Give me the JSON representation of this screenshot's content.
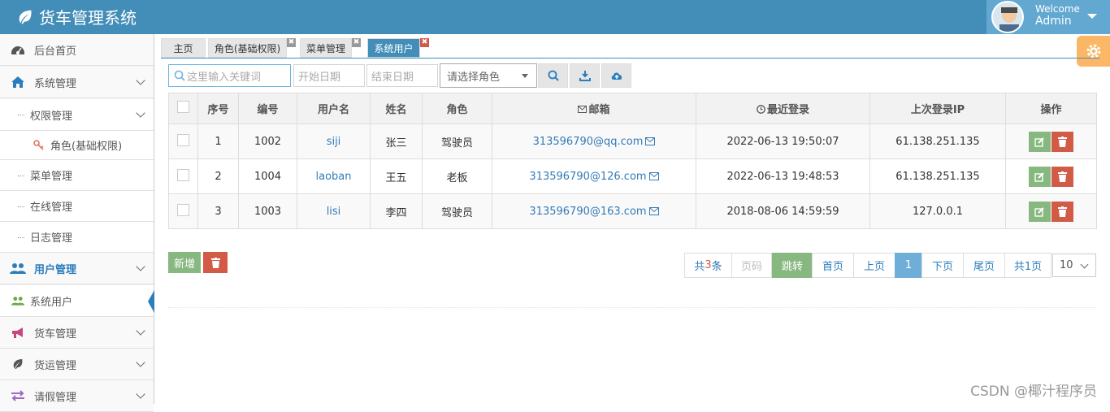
{
  "app": {
    "title": "货车管理系统"
  },
  "user": {
    "welcome": "Welcome",
    "name": "Admin"
  },
  "sidebar": {
    "items": [
      {
        "label": "后台首页",
        "icon": "dashboard-icon"
      },
      {
        "label": "系统管理",
        "icon": "home-icon"
      },
      {
        "label": "权限管理"
      },
      {
        "label": "角色(基础权限)",
        "icon": "key-icon"
      },
      {
        "label": "菜单管理"
      },
      {
        "label": "在线管理"
      },
      {
        "label": "日志管理"
      },
      {
        "label": "用户管理",
        "icon": "users-icon"
      },
      {
        "label": "系统用户",
        "icon": "users-icon"
      },
      {
        "label": "货车管理",
        "icon": "bullhorn-icon"
      },
      {
        "label": "货运管理",
        "icon": "leaf-icon"
      },
      {
        "label": "请假管理",
        "icon": "exchange-icon"
      }
    ]
  },
  "tabs": [
    {
      "label": "主页"
    },
    {
      "label": "角色(基础权限)"
    },
    {
      "label": "菜单管理"
    },
    {
      "label": "系统用户"
    }
  ],
  "toolbar": {
    "search_placeholder": "这里输入关键词",
    "start_date": "开始日期",
    "end_date": "结束日期",
    "role_select": "请选择角色"
  },
  "table": {
    "headers": [
      "序号",
      "编号",
      "用户名",
      "姓名",
      "角色",
      "邮箱",
      "最近登录",
      "上次登录IP",
      "操作"
    ],
    "rows": [
      {
        "seq": "1",
        "id": "1002",
        "username": "siji",
        "name": "张三",
        "role": "驾驶员",
        "email": "313596790@qq.com",
        "last_login": "2022-06-13 19:50:07",
        "ip": "61.138.251.135"
      },
      {
        "seq": "2",
        "id": "1004",
        "username": "laoban",
        "name": "王五",
        "role": "老板",
        "email": "313596790@126.com",
        "last_login": "2022-06-13 19:48:53",
        "ip": "61.138.251.135"
      },
      {
        "seq": "3",
        "id": "1003",
        "username": "lisi",
        "name": "李四",
        "role": "驾驶员",
        "email": "313596790@163.com",
        "last_login": "2018-08-06 14:59:59",
        "ip": "127.0.0.1"
      }
    ]
  },
  "actions": {
    "add": "新增"
  },
  "pagination": {
    "total_prefix": "共",
    "total_count": "3",
    "total_suffix": "条",
    "page_input": "页码",
    "jump": "跳转",
    "first": "首页",
    "prev": "上页",
    "current": "1",
    "next": "下页",
    "last": "尾页",
    "pages": "共1页",
    "page_size": "10"
  },
  "watermark": "CSDN @椰汁程序员",
  "colors": {
    "header": "#438eb9",
    "user_area": "#62a8d1",
    "edit": "#87b87f",
    "delete": "#d15b47",
    "settings": "#fbb765"
  }
}
